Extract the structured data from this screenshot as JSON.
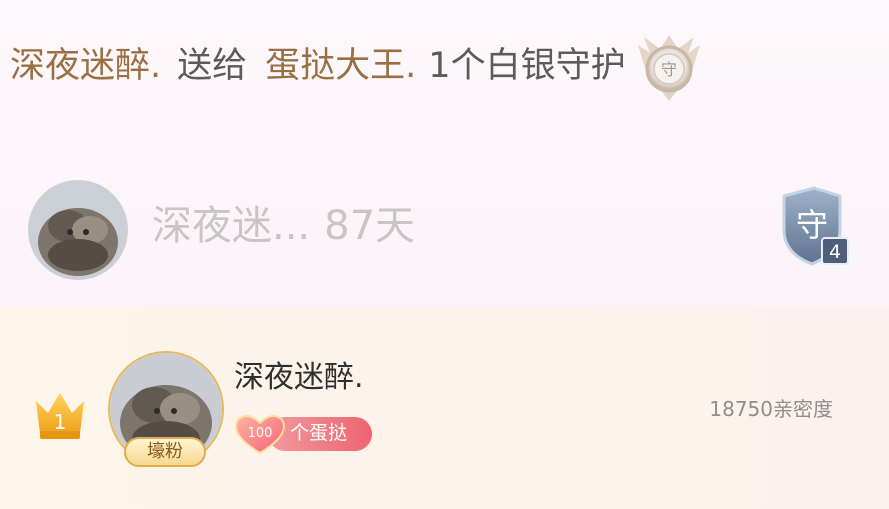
{
  "gift_message": {
    "sender": "深夜迷醉.",
    "action": "送给",
    "receiver": "蛋挞大王.",
    "item": "1个白银守护",
    "badge_icon": "silver-guard-emblem-icon",
    "sender_color": "#9a6f44",
    "text_color": "#5d5a5c"
  },
  "guard": {
    "name": "深夜迷...",
    "days": "87天",
    "badge_icon": "guard-shield-icon",
    "badge_level": "4",
    "badge_char": "守"
  },
  "ranking": {
    "rank": "1",
    "rank_icon": "gold-crown-icon",
    "username": "深夜迷醉.",
    "fan_tag": "壕粉",
    "gift_count": "100",
    "gift_label": "个蛋挞",
    "intimacy": "18750亲密度",
    "accent": "#ee6470",
    "gold": "#e7b85e"
  }
}
